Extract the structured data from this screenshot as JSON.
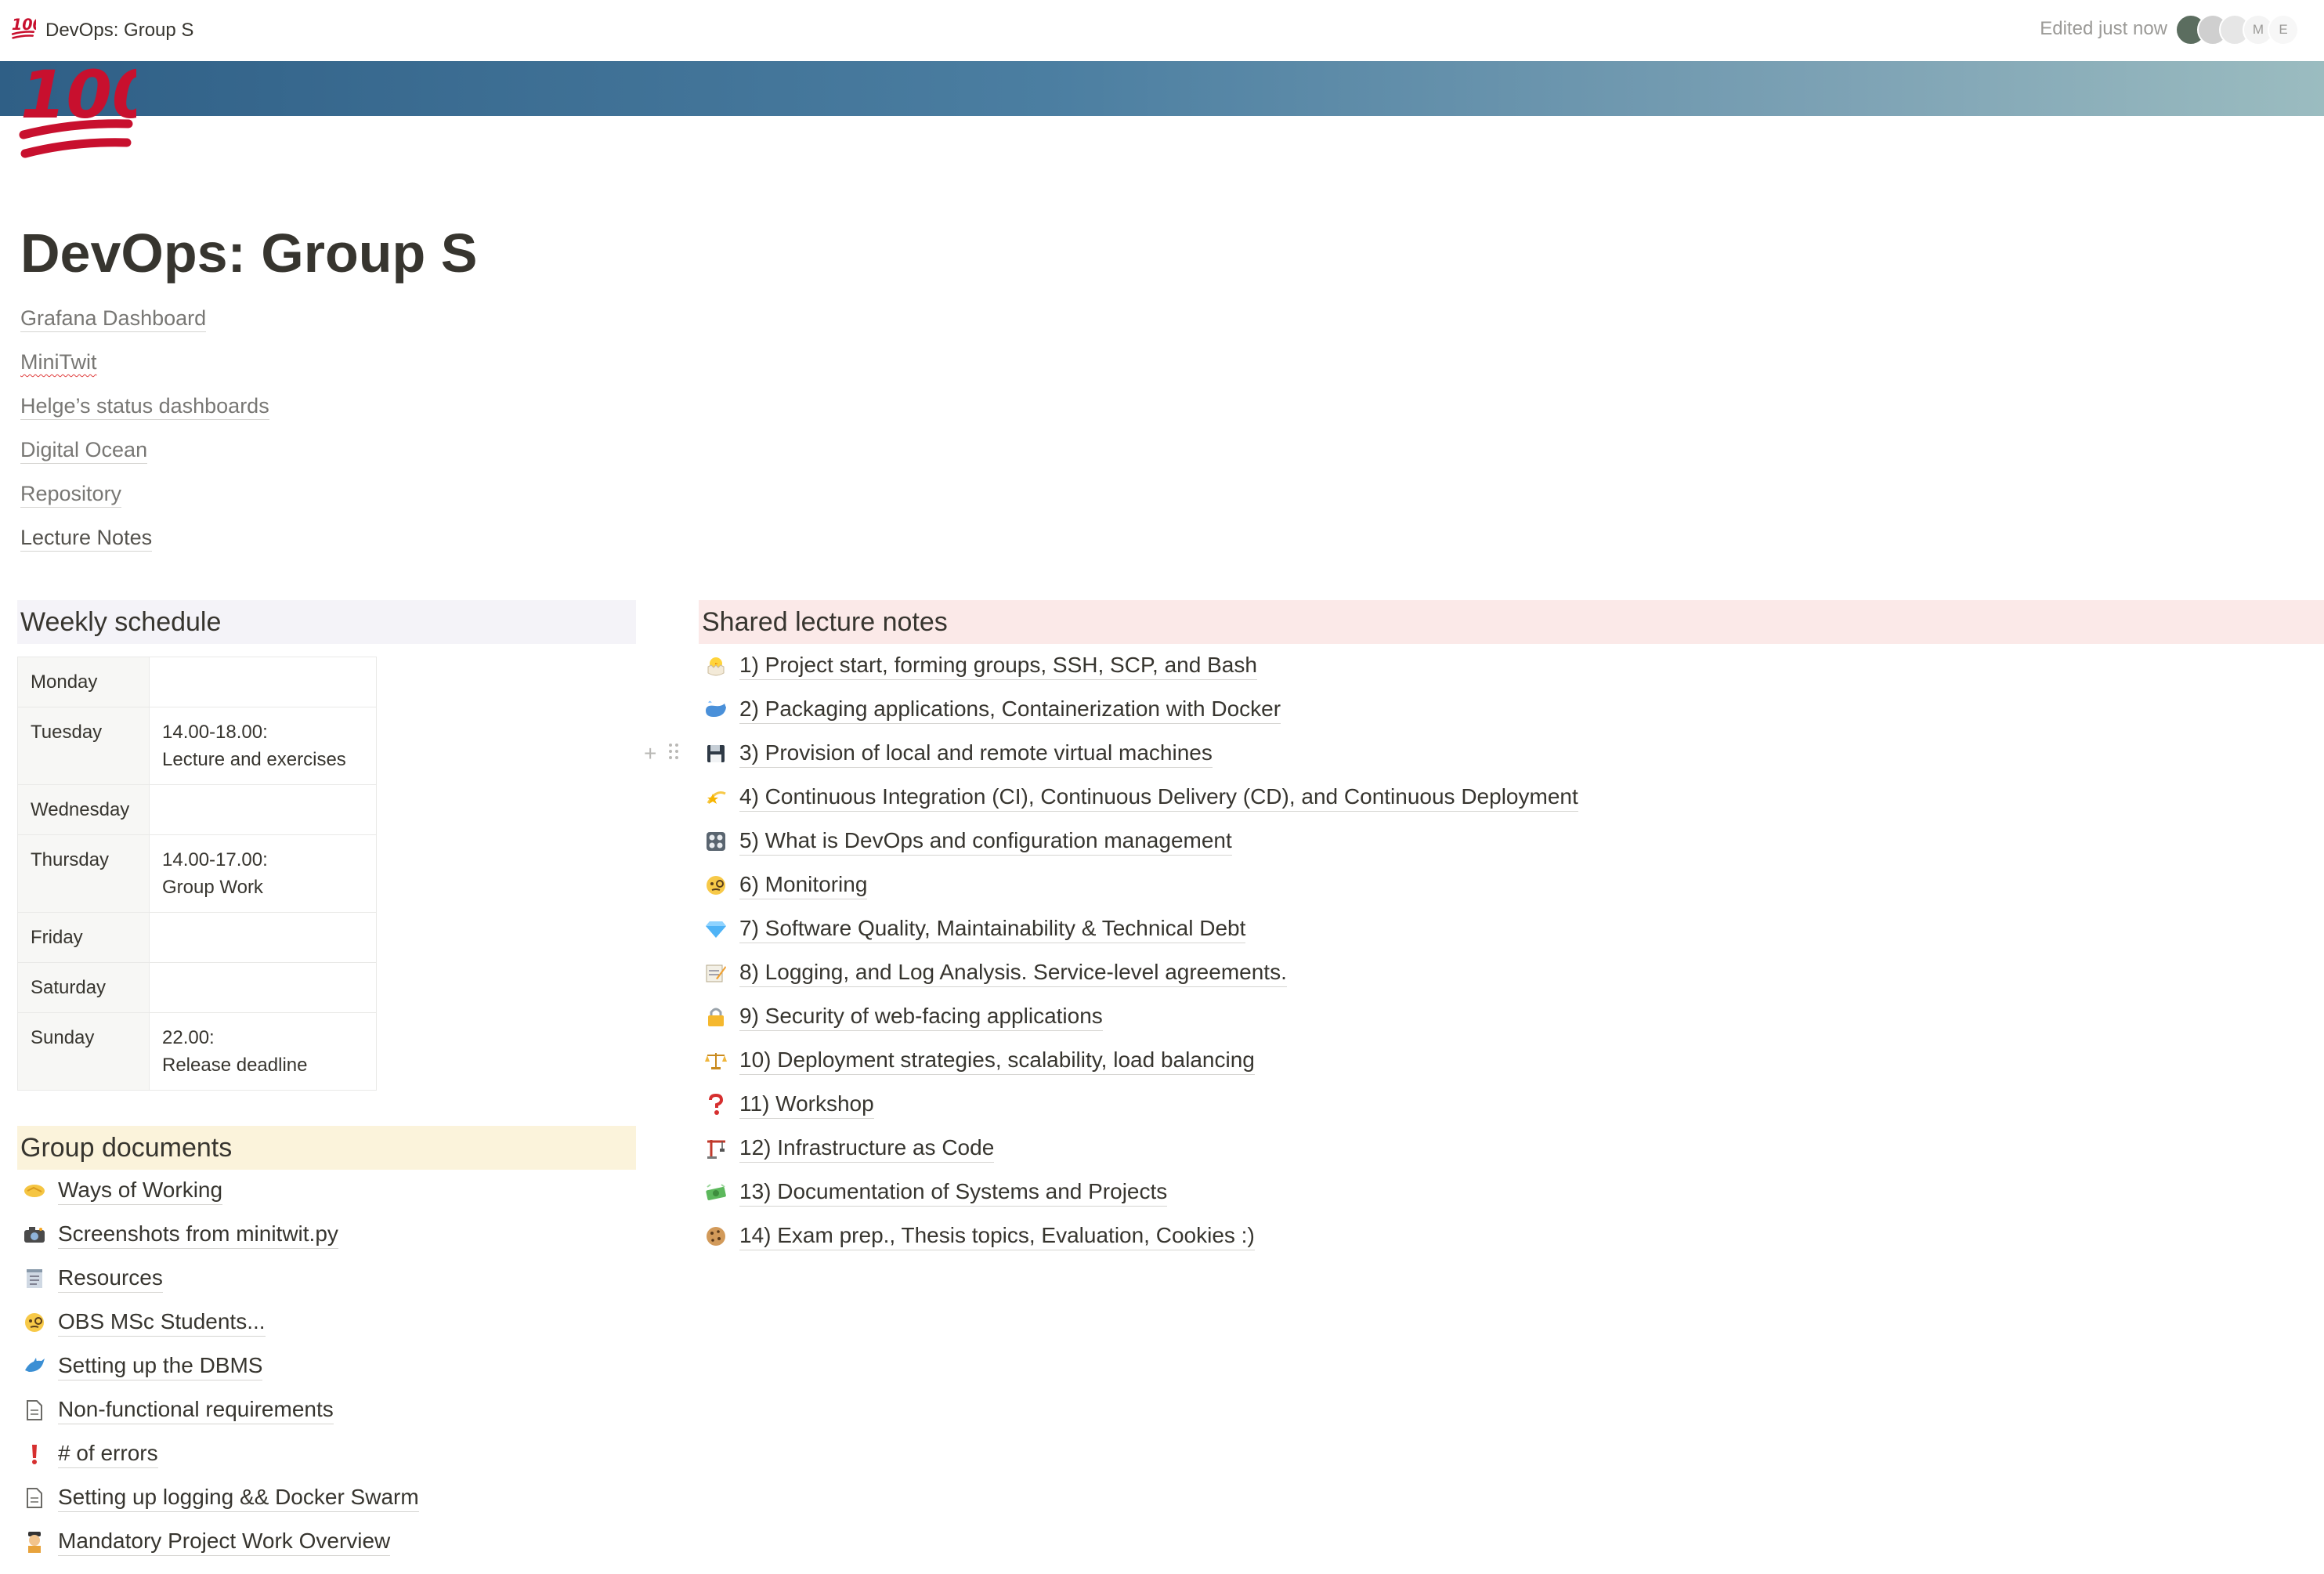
{
  "topbar": {
    "icon": "100-emoji",
    "title": "DevOps: Group S",
    "edited": "Edited just now",
    "avatars": [
      "",
      "",
      "",
      "M",
      "E"
    ]
  },
  "page": {
    "icon": "100-emoji",
    "title": "DevOps: Group S",
    "links": [
      "Grafana Dashboard",
      "MiniTwit",
      "Helge’s status dashboards",
      "Digital Ocean",
      "Repository",
      "Lecture Notes"
    ]
  },
  "weekly": {
    "title": "Weekly schedule",
    "rows": [
      {
        "day": "Monday",
        "line1": "",
        "line2": ""
      },
      {
        "day": "Tuesday",
        "line1": "14.00-18.00:",
        "line2": "Lecture and exercises"
      },
      {
        "day": "Wednesday",
        "line1": "",
        "line2": ""
      },
      {
        "day": "Thursday",
        "line1": "14.00-17.00:",
        "line2": "Group Work"
      },
      {
        "day": "Friday",
        "line1": "",
        "line2": ""
      },
      {
        "day": "Saturday",
        "line1": "",
        "line2": ""
      },
      {
        "day": "Sunday",
        "line1": "22.00:",
        "line2": "Release deadline"
      }
    ]
  },
  "group_docs": {
    "title": "Group documents",
    "items": [
      {
        "icon": "handshake-icon",
        "label": "Ways of Working"
      },
      {
        "icon": "camera-icon",
        "label": "Screenshots from minitwit.py"
      },
      {
        "icon": "notepad-icon",
        "label": "Resources"
      },
      {
        "icon": "monocle-face-icon",
        "label": "OBS MSc Students..."
      },
      {
        "icon": "dolphin-icon",
        "label": "Setting up the DBMS"
      },
      {
        "icon": "page-icon",
        "label": "Non-functional requirements"
      },
      {
        "icon": "exclamation-icon",
        "label": "# of errors"
      },
      {
        "icon": "page-icon",
        "label": "Setting up logging && Docker Swarm"
      },
      {
        "icon": "pilot-icon",
        "label": "Mandatory Project Work Overview"
      }
    ]
  },
  "shared_notes": {
    "title": "Shared lecture notes",
    "items": [
      {
        "icon": "hatching-chick-icon",
        "label": "1) Project start, forming groups, SSH, SCP, and Bash"
      },
      {
        "icon": "whale-icon",
        "label": "2) Packaging applications, Containerization with Docker"
      },
      {
        "icon": "floppy-disk-icon",
        "label": "3) Provision of local and remote virtual machines"
      },
      {
        "icon": "dizzy-star-icon",
        "label": "4) Continuous Integration (CI), Continuous Delivery (CD), and Continuous Deployment"
      },
      {
        "icon": "control-knobs-icon",
        "label": "5) What is DevOps and configuration management"
      },
      {
        "icon": "monocle-face-icon",
        "label": "6) Monitoring"
      },
      {
        "icon": "gem-icon",
        "label": "7) Software Quality, Maintainability & Technical Debt"
      },
      {
        "icon": "memo-icon",
        "label": "8) Logging, and Log Analysis. Service-level agreements."
      },
      {
        "icon": "lock-icon",
        "label": "9) Security of web-facing applications"
      },
      {
        "icon": "balance-scale-icon",
        "label": "10) Deployment strategies, scalability, load balancing"
      },
      {
        "icon": "question-icon",
        "label": "11) Workshop"
      },
      {
        "icon": "crane-icon",
        "label": "12) Infrastructure as Code"
      },
      {
        "icon": "money-icon",
        "label": "13) Documentation of Systems and Projects"
      },
      {
        "icon": "cookie-icon",
        "label": "14) Exam prep., Thesis topics, Evaluation, Cookies :)"
      }
    ]
  },
  "colors": {
    "weekly_bg": "#f4f3f8",
    "shared_bg": "#fbe9e8",
    "group_bg": "#fbf3db",
    "text": "#37352f",
    "muted": "#787774",
    "hundred_red": "#c8102e"
  }
}
